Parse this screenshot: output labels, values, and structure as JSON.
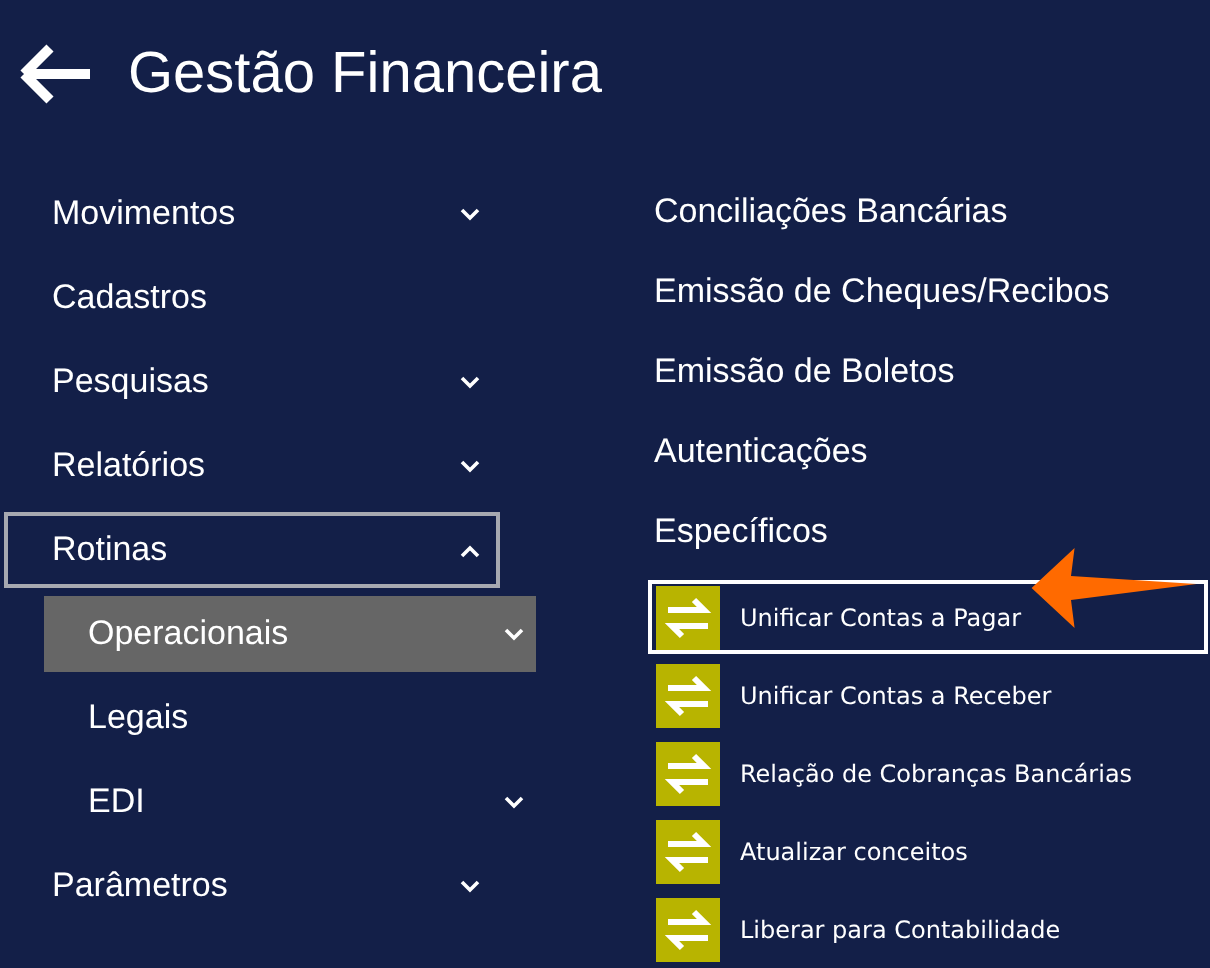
{
  "header": {
    "title": "Gestão Financeira"
  },
  "menu": [
    {
      "label": "Movimentos",
      "kind": "group",
      "expanded": false,
      "selected": false
    },
    {
      "label": "Cadastros",
      "kind": "leaf",
      "selected": false
    },
    {
      "label": "Pesquisas",
      "kind": "group",
      "expanded": false,
      "selected": false
    },
    {
      "label": "Relatórios",
      "kind": "group",
      "expanded": false,
      "selected": false
    },
    {
      "label": "Rotinas",
      "kind": "group",
      "expanded": true,
      "selected": true,
      "children": [
        {
          "label": "Operacionais",
          "kind": "group",
          "expanded": false,
          "selected": true
        },
        {
          "label": "Legais",
          "kind": "leaf",
          "selected": false
        },
        {
          "label": "EDI",
          "kind": "group",
          "expanded": false,
          "selected": false
        }
      ]
    },
    {
      "label": "Parâmetros",
      "kind": "group",
      "expanded": false,
      "selected": false
    }
  ],
  "sections": [
    "Conciliações Bancárias",
    "Emissão de Cheques/Recibos",
    "Emissão de Boletos",
    "Autenticações",
    "Específicos"
  ],
  "actions": [
    {
      "label": "Unificar Contas a Pagar",
      "selected": true
    },
    {
      "label": "Unificar Contas a Receber",
      "selected": false
    },
    {
      "label": "Relação de Cobranças Bancárias",
      "selected": false
    },
    {
      "label": "Atualizar conceitos",
      "selected": false
    },
    {
      "label": "Liberar para Contabilidade",
      "selected": false
    }
  ]
}
